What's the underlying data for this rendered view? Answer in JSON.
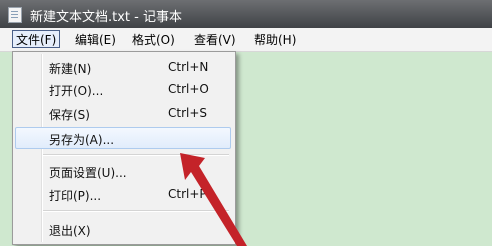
{
  "window": {
    "title": "新建文本文档.txt - 记事本"
  },
  "menubar": {
    "file": "文件(F)",
    "edit": "编辑(E)",
    "format": "格式(O)",
    "view": "查看(V)",
    "help": "帮助(H)"
  },
  "file_menu": {
    "new": {
      "label": "新建(N)",
      "shortcut": "Ctrl+N"
    },
    "open": {
      "label": "打开(O)...",
      "shortcut": "Ctrl+O"
    },
    "save": {
      "label": "保存(S)",
      "shortcut": "Ctrl+S"
    },
    "save_as": {
      "label": "另存为(A)..."
    },
    "page_setup": {
      "label": "页面设置(U)..."
    },
    "print": {
      "label": "打印(P)...",
      "shortcut": "Ctrl+P"
    },
    "exit": {
      "label": "退出(X)"
    }
  },
  "annotation": {
    "arrow_color": "#c42329"
  }
}
